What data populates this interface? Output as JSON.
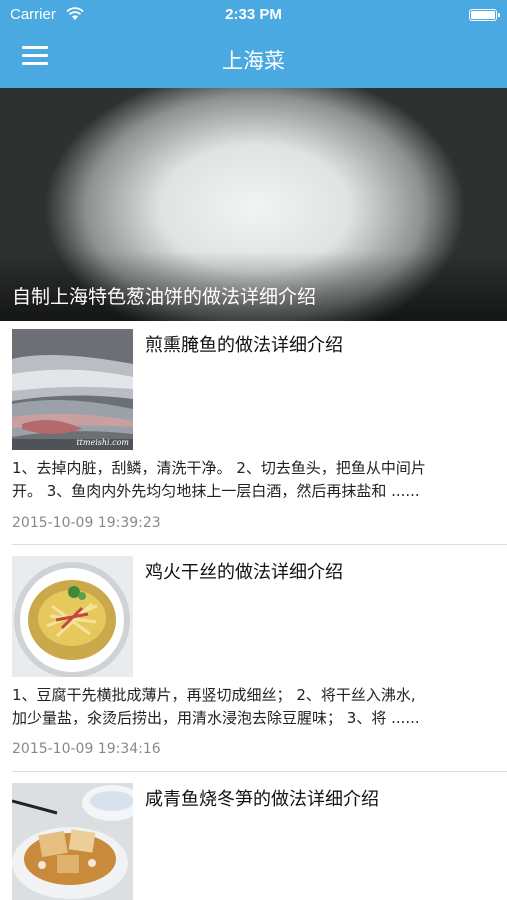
{
  "status_bar": {
    "carrier": "Carrier",
    "time": "2:33 PM"
  },
  "header": {
    "title": "上海菜",
    "menu_icon": "hamburger-menu-icon",
    "background_color": "#4aa9e0"
  },
  "banner": {
    "caption": "自制上海特色葱油饼的做法详细介绍"
  },
  "articles": [
    {
      "title": "煎熏腌鱼的做法详细介绍",
      "summary_line1": "1、去掉内脏，刮鳞，清洗干净。 2、切去鱼头，把鱼从中间片",
      "summary_line2": "开。 3、鱼肉内外先均匀地抹上一层白酒，然后再抹盐和 ......",
      "date": "2015-10-09 19:39:23",
      "thumb_watermark": "ttmeishi.com"
    },
    {
      "title": "鸡火干丝的做法详细介绍",
      "summary_line1": "1、豆腐干先横批成薄片，再竖切成细丝； 2、将干丝入沸水,",
      "summary_line2": "加少量盐，氽烫后捞出，用清水浸泡去除豆腥味； 3、将 ......",
      "date": "2015-10-09 19:34:16"
    },
    {
      "title": "咸青鱼烧冬笋的做法详细介绍"
    }
  ]
}
